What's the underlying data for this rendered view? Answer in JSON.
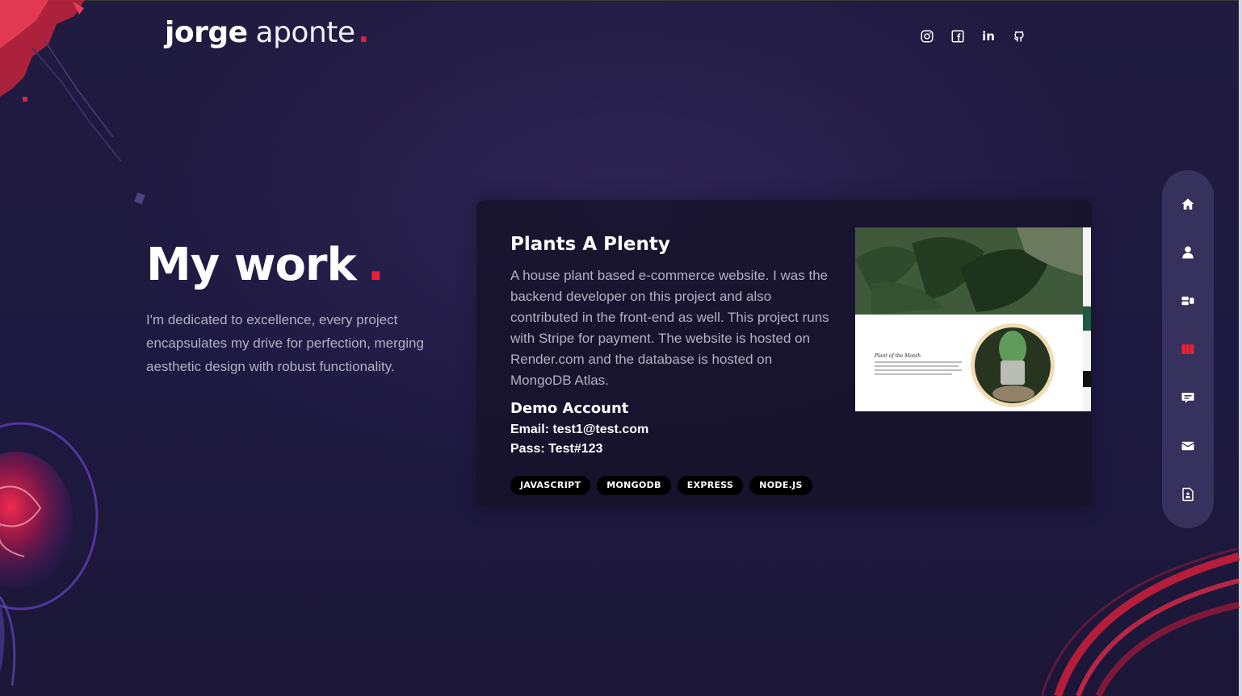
{
  "header": {
    "logo_first": "jorge",
    "logo_last": "aponte",
    "logo_dot": ".",
    "socials": [
      {
        "icon": "instagram-icon"
      },
      {
        "icon": "facebook-icon"
      },
      {
        "icon": "linkedin-icon",
        "text": "in"
      },
      {
        "icon": "github-icon"
      }
    ]
  },
  "intro": {
    "title": "My work",
    "title_dot": ".",
    "text": "I'm dedicated to excellence, every project encapsulates my drive for perfection, merging aesthetic design with robust functionality."
  },
  "project": {
    "title": "Plants A Plenty",
    "description": "A house plant based e-commerce website. I was the backend developer on this project and also contributed in the front-end as well. This project runs with Stripe for payment. The website is hosted on Render.com and the database is hosted on MongoDB Atlas.",
    "demo_title": "Demo Account",
    "demo_email": "Email: test1@test.com",
    "demo_pass": "Pass: Test#123",
    "tags": [
      "JAVASCRIPT",
      "MONGODB",
      "EXPRESS",
      "NODE.JS"
    ],
    "preview_caption": "Plant of the Month"
  },
  "sidenav": {
    "items": [
      {
        "icon": "home-icon",
        "active": false
      },
      {
        "icon": "user-icon",
        "active": false
      },
      {
        "icon": "services-icon",
        "active": false
      },
      {
        "icon": "work-icon",
        "active": true
      },
      {
        "icon": "testimonials-icon",
        "active": false
      },
      {
        "icon": "mail-icon",
        "active": false
      },
      {
        "icon": "resume-icon",
        "active": false
      }
    ]
  },
  "colors": {
    "accent": "#e8203a",
    "background": "#1f1a3c",
    "text_muted": "#b3b0c2",
    "nav_bg": "#3a3460"
  }
}
